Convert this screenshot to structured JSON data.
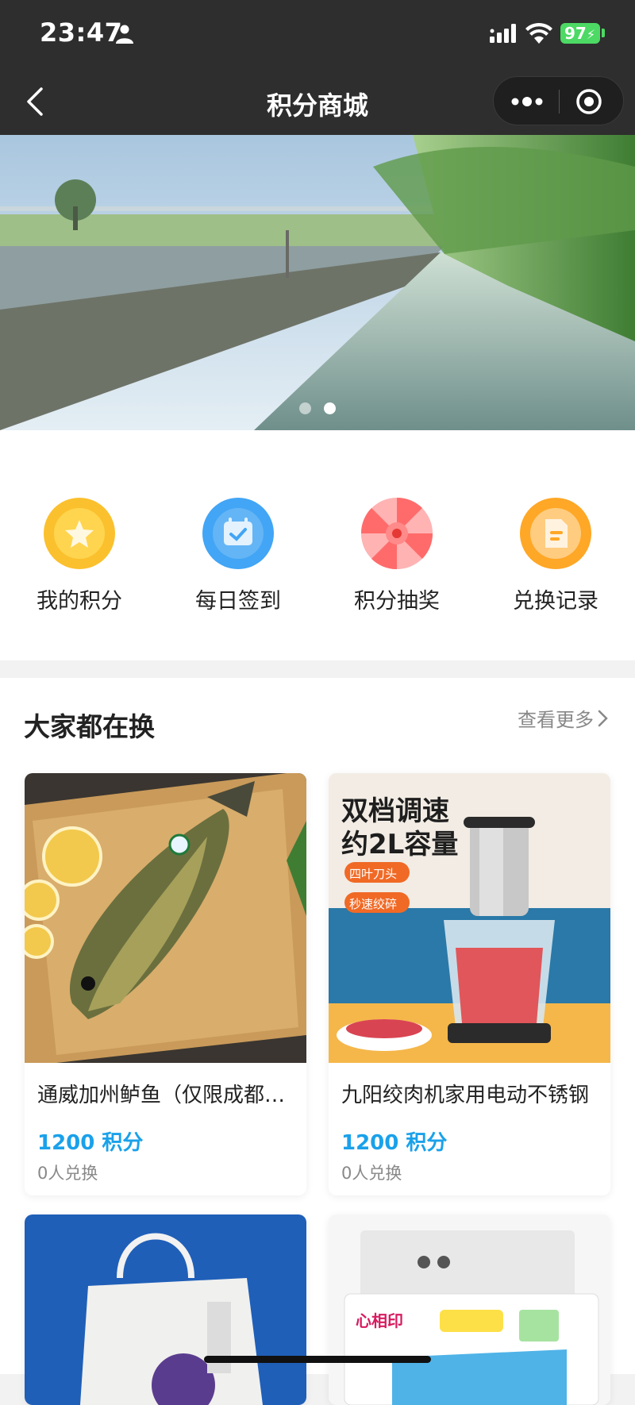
{
  "status_bar": {
    "time": "23:47",
    "battery": "97"
  },
  "nav": {
    "title": "积分商城"
  },
  "banner": {
    "active_dot": 2,
    "dot_count": 2
  },
  "quick_actions": [
    {
      "label": "我的积分",
      "icon": "star-coin-icon",
      "color": "#fbc02d"
    },
    {
      "label": "每日签到",
      "icon": "calendar-check-icon",
      "color": "#42a5f5"
    },
    {
      "label": "积分抽奖",
      "icon": "lottery-wheel-icon",
      "color": "#ff6b6b"
    },
    {
      "label": "兑换记录",
      "icon": "document-icon",
      "color": "#ffa726"
    }
  ],
  "section": {
    "title": "大家都在换",
    "more_label": "查看更多"
  },
  "products": [
    {
      "name": "通威加州鲈鱼（仅限成都地区）",
      "points": "1200 积分",
      "sold": "0人兑换"
    },
    {
      "name": "九阳绞肉机家用电动不锈钢",
      "points": "1200 积分",
      "sold": "0人兑换",
      "image_text": {
        "headline1": "双档调速",
        "headline2": "约2L容量",
        "tag1": "四叶刀头",
        "tag2": "秒速绞碎"
      }
    },
    {
      "name": "",
      "points": "",
      "sold": ""
    },
    {
      "name": "",
      "points": "",
      "sold": "",
      "image_text": {
        "brand": "心相印"
      }
    }
  ]
}
